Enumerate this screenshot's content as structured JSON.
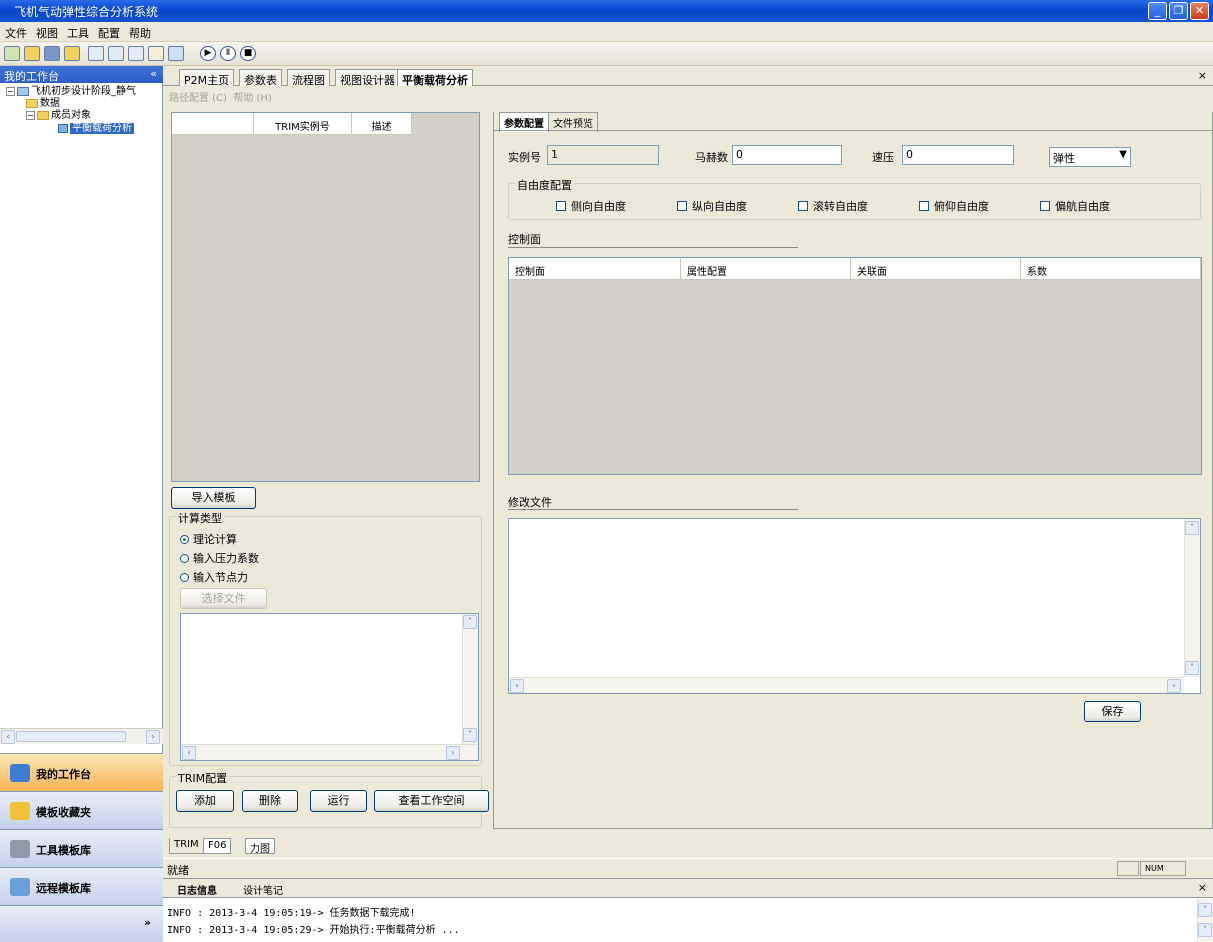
{
  "window": {
    "title": "飞机气动弹性综合分析系统"
  },
  "menu": [
    "文件",
    "视图",
    "工具",
    "配置",
    "帮助"
  ],
  "sidebar": {
    "title": "我的工作台",
    "tree": {
      "root": "飞机初步设计阶段_静气",
      "data": "数据",
      "members": "成员对象",
      "selected": "平衡载荷分析"
    },
    "nav": [
      "我的工作台",
      "模板收藏夹",
      "工具模板库",
      "远程模板库"
    ]
  },
  "tabs": [
    "P2M主页",
    "参数表",
    "流程图",
    "视图设计器",
    "平衡载荷分析"
  ],
  "subtoolbar": [
    "路径配置 (C)",
    "帮助 (H)"
  ],
  "trim_table": {
    "headers": [
      "TRIM实例号",
      "描述"
    ]
  },
  "left_controls": {
    "import_button": "导入模板",
    "calc_type_title": "计算类型",
    "calc_options": [
      "理论计算",
      "输入压力系数",
      "输入节点力"
    ],
    "select_file_button": "选择文件",
    "trim_config_title": "TRIM配置",
    "buttons": [
      "添加",
      "删除",
      "运行",
      "查看工作空间"
    ]
  },
  "right_tabs": [
    "参数配置",
    "文件预览"
  ],
  "params": {
    "instance_label": "实例号",
    "instance_value": "1",
    "mach_label": "马赫数",
    "mach_value": "0",
    "pressure_label": "速压",
    "pressure_value": "0",
    "mode_value": "弹性"
  },
  "dof": {
    "title": "自由度配置",
    "items": [
      "侧向自由度",
      "纵向自由度",
      "滚转自由度",
      "俯仰自由度",
      "偏航自由度"
    ]
  },
  "control_surface": {
    "title": "控制面",
    "headers": [
      "控制面",
      "属性配置",
      "关联面",
      "系数"
    ]
  },
  "modify_file": {
    "title": "修改文件",
    "save_button": "保存"
  },
  "bottom_tabs": [
    "TRIM",
    "F06",
    "力图"
  ],
  "status": {
    "text": "就绪",
    "num": "NUM"
  },
  "log": {
    "tabs": [
      "日志信息",
      "设计笔记"
    ],
    "lines": [
      "INFO : 2013-3-4 19:05:19-> 任务数据下载完成!",
      "INFO : 2013-3-4 19:05:29-> 开始执行:平衡载荷分析 ..."
    ]
  }
}
